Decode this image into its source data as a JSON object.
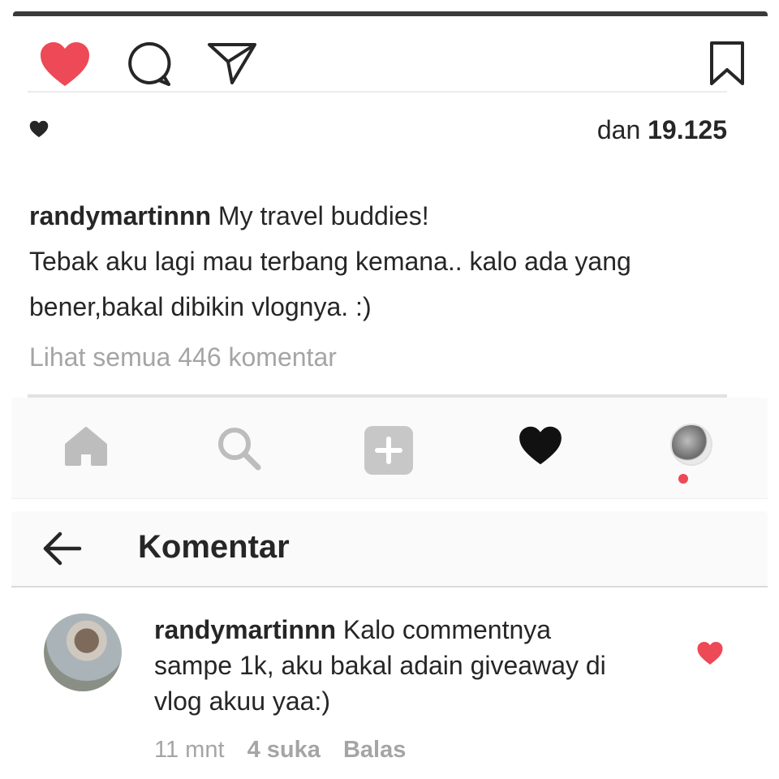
{
  "post": {
    "likes_prefix": "dan",
    "likes_count": "19.125",
    "caption": {
      "username": "randymartinnn",
      "text_line1": "My travel buddies!",
      "text_line2": "Tebak aku lagi mau terbang kemana.. kalo ada yang",
      "text_line3": "bener,bakal dibikin vlognya. :)"
    },
    "view_all_comments": "Lihat semua 446 komentar"
  },
  "icons": {
    "like": "heart-icon",
    "comment": "comment-icon",
    "share": "send-icon",
    "bookmark": "bookmark-icon"
  },
  "colors": {
    "like_red": "#ed4956",
    "muted_text": "#a5a5a5",
    "nav_gray": "#bdbdbd"
  },
  "bottom_nav": {
    "items": [
      "home-icon",
      "search-icon",
      "add-icon",
      "activity-heart-icon",
      "profile-avatar"
    ],
    "active": "activity-heart-icon"
  },
  "comments_page": {
    "title": "Komentar",
    "comment": {
      "username": "randymartinnn",
      "text_line1": "Kalo commentnya",
      "text_line2": "sampe 1k, aku bakal adain giveaway di",
      "text_line3": "vlog akuu yaa:)",
      "time": "11 mnt",
      "likes": "4 suka",
      "reply": "Balas"
    }
  }
}
